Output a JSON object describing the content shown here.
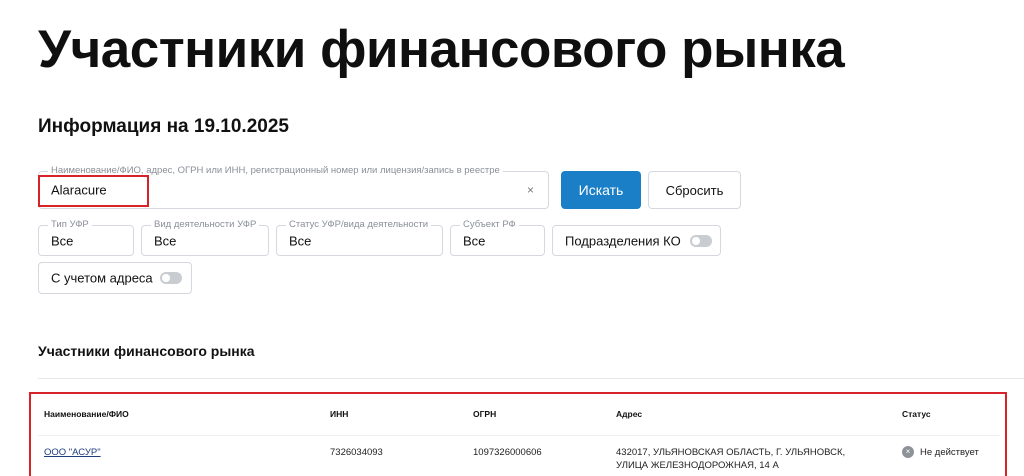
{
  "page": {
    "title": "Участники финансового рынка",
    "subtitle": "Информация на 19.10.2025"
  },
  "search": {
    "legend": "Наименование/ФИО, адрес, ОГРН или ИНН, регистрационный номер или лицензия/запись в реестре",
    "value": "Alaracure",
    "clear_icon": "×",
    "search_button": "Искать",
    "reset_button": "Сбросить"
  },
  "filters": [
    {
      "legend": "Тип УФР",
      "value": "Все"
    },
    {
      "legend": "Вид деятельности УФР",
      "value": "Все"
    },
    {
      "legend": "Статус УФР/вида деятельности",
      "value": "Все"
    },
    {
      "legend": "Субъект РФ",
      "value": "Все"
    }
  ],
  "toggles": {
    "subdivisions": {
      "label": "Подразделения КО",
      "on": false
    },
    "with_address": {
      "label": "С учетом адреса",
      "on": false
    }
  },
  "results": {
    "section_title": "Участники финансового рынка",
    "columns": [
      "Наименование/ФИО",
      "ИНН",
      "ОГРН",
      "Адрес",
      "Статус"
    ],
    "rows": [
      {
        "name": "ООО \"АСУР\"",
        "inn": "7326034093",
        "ogrn": "1097326000606",
        "address_line1": "432017, УЛЬЯНОВСКАЯ ОБЛАСТЬ, Г. УЛЬЯНОВСК,",
        "address_line2": "УЛИЦА ЖЕЛЕЗНОДОРОЖНАЯ, 14 А",
        "status": "Не действует",
        "status_icon": "×"
      }
    ]
  },
  "colors": {
    "accent": "#1a7fc6",
    "highlight": "#d8222a",
    "status_inactive": "#8e939a"
  }
}
